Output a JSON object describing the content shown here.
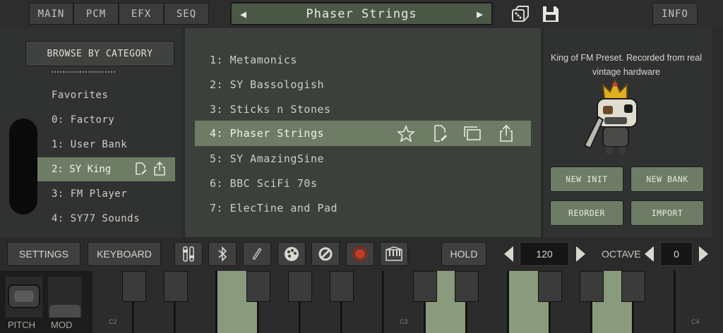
{
  "tabs": [
    {
      "label": "MAIN"
    },
    {
      "label": "PCM"
    },
    {
      "label": "EFX"
    },
    {
      "label": "SEQ"
    }
  ],
  "preset_selector": {
    "name": "Phaser Strings",
    "prev_icon": "triangle-left",
    "next_icon": "triangle-right"
  },
  "header_icons": {
    "random": "dice-icon",
    "save": "floppy-save-icon"
  },
  "info_label": "INFO",
  "browse_label": "BROWSE BY CATEGORY",
  "categories": [
    {
      "label": "Favorites"
    },
    {
      "label": "0: Factory"
    },
    {
      "label": "1: User Bank"
    },
    {
      "label": "2: SY King"
    },
    {
      "label": "3: FM Player"
    },
    {
      "label": "4: SY77 Sounds"
    }
  ],
  "selected_category_index": 3,
  "presets": [
    {
      "label": "1: Metamonics"
    },
    {
      "label": "2: SY Bassologish"
    },
    {
      "label": "3: Sticks n Stones"
    },
    {
      "label": "4: Phaser Strings"
    },
    {
      "label": "5: SY AmazingSine"
    },
    {
      "label": "6: BBC SciFi 70s"
    },
    {
      "label": "7: ElecTine and Pad"
    }
  ],
  "selected_preset_index": 3,
  "description": "King of FM Preset. Recorded from real vintage hardware",
  "actions": {
    "new_init": "NEW INIT",
    "new_bank": "NEW BANK",
    "reorder": "REORDER",
    "import": "IMPORT"
  },
  "toolbar": {
    "settings": "SETTINGS",
    "keyboard": "KEYBOARD",
    "hold": "HOLD",
    "tempo": "120",
    "octave_label": "OCTAVE",
    "octave": "0",
    "icons": [
      "mixer-icon",
      "bluetooth-icon",
      "link-icon",
      "palette-icon",
      "disable-icon",
      "record-icon",
      "piano-icon"
    ]
  },
  "keyboard": {
    "pitch_label": "PITCH",
    "mod_label": "MOD",
    "octave_labels": [
      "C2",
      "C3",
      "C4"
    ]
  },
  "colors": {
    "accent_green": "#6e7c66",
    "selector_green": "#4b5846",
    "pressed_key": "#8a9a7c",
    "record_red": "#c03a24"
  }
}
